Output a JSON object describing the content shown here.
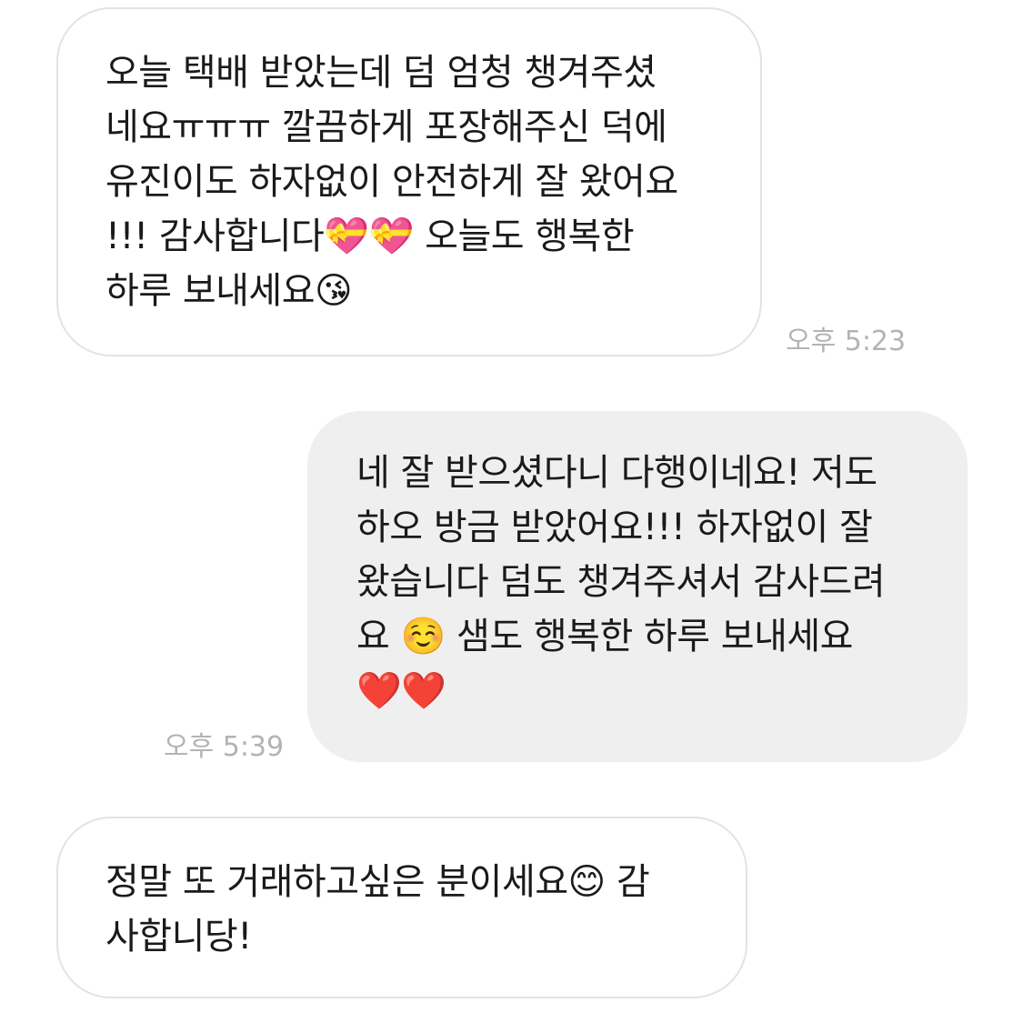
{
  "messages": [
    {
      "direction": "incoming",
      "text": "오늘 택배 받았는데 덤 엄청 챙겨주셨\n네요ㅠㅠㅠ 깔끔하게 포장해주신 덕에\n유진이도 하자없이 안전하게 잘 왔어요\n!!! 감사합니다💝💝 오늘도 행복한\n하루 보내세요😘",
      "time": "오후 5:23"
    },
    {
      "direction": "outgoing",
      "text": "네 잘 받으셨다니 다행이네요! 저도\n하오 방금 받았어요!!! 하자없이 잘\n왔습니다 덤도 챙겨주셔서 감사드려\n요 ☺️ 샘도 행복한 하루 보내세요\n❤️❤️",
      "time": "오후 5:39"
    },
    {
      "direction": "incoming",
      "text": "정말 또 거래하고싶은 분이세요😊 감\n사합니당!"
    }
  ],
  "colors": {
    "incoming_bubble": "#ffffff",
    "incoming_border": "#e3e3e3",
    "outgoing_bubble": "#efefef",
    "timestamp": "#b3b3b3",
    "text": "#1a1a1a"
  }
}
